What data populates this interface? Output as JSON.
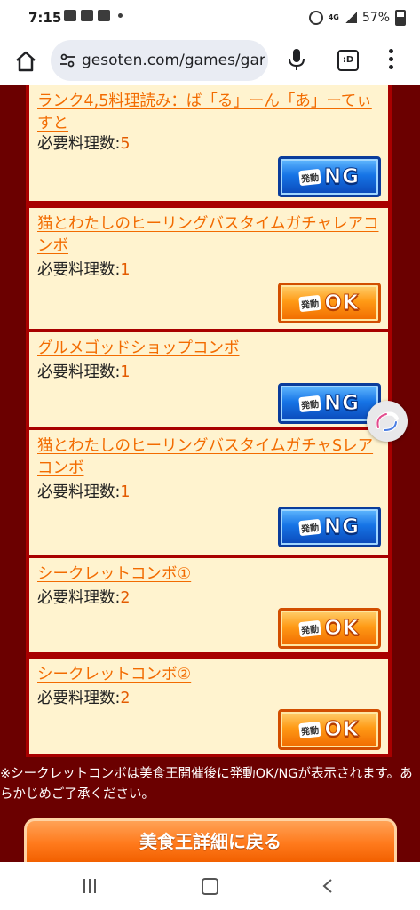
{
  "status_bar": {
    "time": "7:15",
    "network": "4G",
    "battery": "57%"
  },
  "browser": {
    "url": "gesoten.com/games/gar",
    "tabs_label": ":D"
  },
  "combos": [
    {
      "name": "ランク4,5料理読み：ば「る」ーん「あ」ーてぃすと",
      "req_label": "必要料理数:",
      "req_value": "5",
      "status": "NG"
    },
    {
      "name": "猫とわたしのヒーリングバスタイムガチャレアコンボ",
      "req_label": "必要料理数:",
      "req_value": "1",
      "status": "OK"
    },
    {
      "name": "グルメゴッドショップコンボ",
      "req_label": "必要料理数:",
      "req_value": "1",
      "status": "NG"
    },
    {
      "name": "猫とわたしのヒーリングバスタイムガチャSレアコンボ",
      "req_label": "必要料理数:",
      "req_value": "1",
      "status": "NG"
    },
    {
      "name": "シークレットコンボ①",
      "req_label": "必要料理数:",
      "req_value": "2",
      "status": "OK"
    },
    {
      "name": "シークレットコンボ②",
      "req_label": "必要料理数:",
      "req_value": "2",
      "status": "OK"
    }
  ],
  "badge_prefix": "発動",
  "note": "※シークレットコンボは美食王開催後に発動OK/NGが表示されます。あらかじめご了承ください。",
  "back_button": "美食王詳細に戻る",
  "colors": {
    "page_bg": "#6b0000",
    "card_bg": "#fff3cf",
    "card_border": "#a80000",
    "link": "#f26b00",
    "ng_blue": "#1674e6",
    "ok_orange": "#ff9a16"
  }
}
